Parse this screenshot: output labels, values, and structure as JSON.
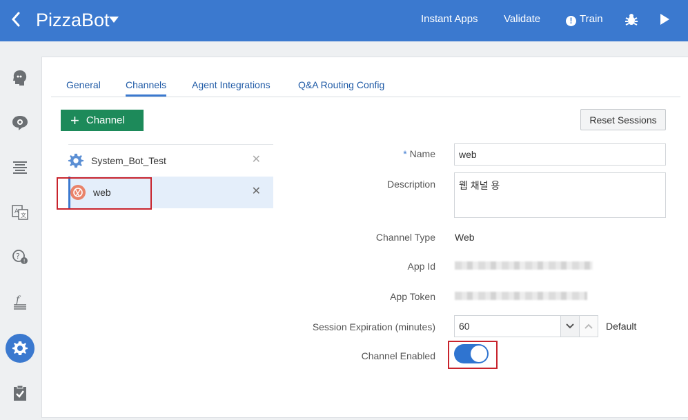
{
  "header": {
    "back_icon": "chevron-left-icon",
    "title": "PizzaBot",
    "nav": {
      "instant_apps": "Instant Apps",
      "validate": "Validate",
      "train": "Train"
    }
  },
  "rail": {
    "items": [
      "intents-icon",
      "entities-icon",
      "flows-icon",
      "resource-bundles-icon",
      "qna-icon",
      "components-icon",
      "settings-icon",
      "quality-icon"
    ],
    "active": "settings-icon"
  },
  "tabs": {
    "general": "General",
    "channels": "Channels",
    "agent": "Agent Integrations",
    "qa": "Q&A Routing Config"
  },
  "buttons": {
    "add_channel": "Channel",
    "reset_sessions": "Reset Sessions"
  },
  "channels": [
    {
      "label": "System_Bot_Test",
      "icon": "gear-icon"
    },
    {
      "label": "web",
      "icon": "web-channel-icon"
    }
  ],
  "form": {
    "name_label": "Name",
    "name_value": "web",
    "description_label": "Description",
    "description_value": "웹 채널 용",
    "channel_type_label": "Channel Type",
    "channel_type_value": "Web",
    "app_id_label": "App Id",
    "app_token_label": "App Token",
    "session_exp_label": "Session Expiration (minutes)",
    "session_exp_value": "60",
    "default_label": "Default",
    "enabled_label": "Channel Enabled",
    "enabled": true
  },
  "colors": {
    "header": "#3b79cf",
    "accent_green": "#1d8a5a",
    "highlight_red": "#c8232c"
  }
}
